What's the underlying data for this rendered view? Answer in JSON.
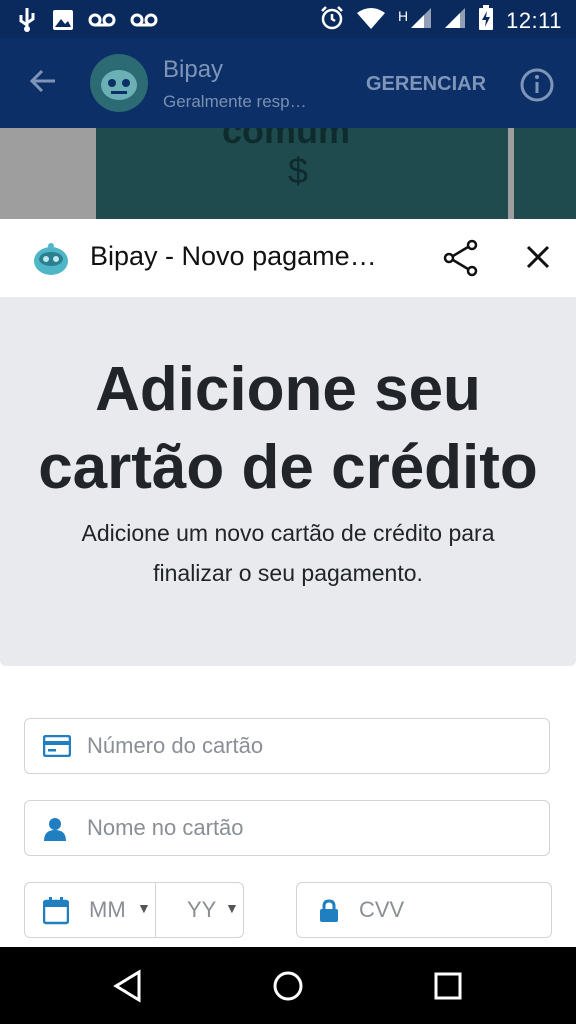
{
  "status_bar": {
    "time": "12:11",
    "network_type": "H",
    "icons": [
      "usb-icon",
      "image-icon",
      "voicemail-icon",
      "voicemail-icon",
      "alarm-icon",
      "wifi-icon",
      "signal-icon",
      "signal-icon",
      "battery-charging-icon"
    ]
  },
  "app_bar": {
    "title": "Bipay",
    "subtitle": "Geralmente resp…",
    "manage_label": "GERENCIAR"
  },
  "background_preview": {
    "text_top": "comum",
    "text_bottom": "$"
  },
  "sheet": {
    "title": "Bipay - Novo pagame…"
  },
  "hero": {
    "heading": "Adicione seu cartão de crédito",
    "description": "Adicione um novo cartão de crédito para finalizar o seu pagamento."
  },
  "form": {
    "card_number_placeholder": "Número do cartão",
    "card_name_placeholder": "Nome no cartão",
    "month_placeholder": "MM",
    "year_placeholder": "YY",
    "cvv_placeholder": "CVV"
  },
  "colors": {
    "status_bar": "#0a2a5e",
    "app_bar": "#0d2f67",
    "hero_bg": "#e8eaed",
    "icon_blue": "#1f7fc1"
  }
}
